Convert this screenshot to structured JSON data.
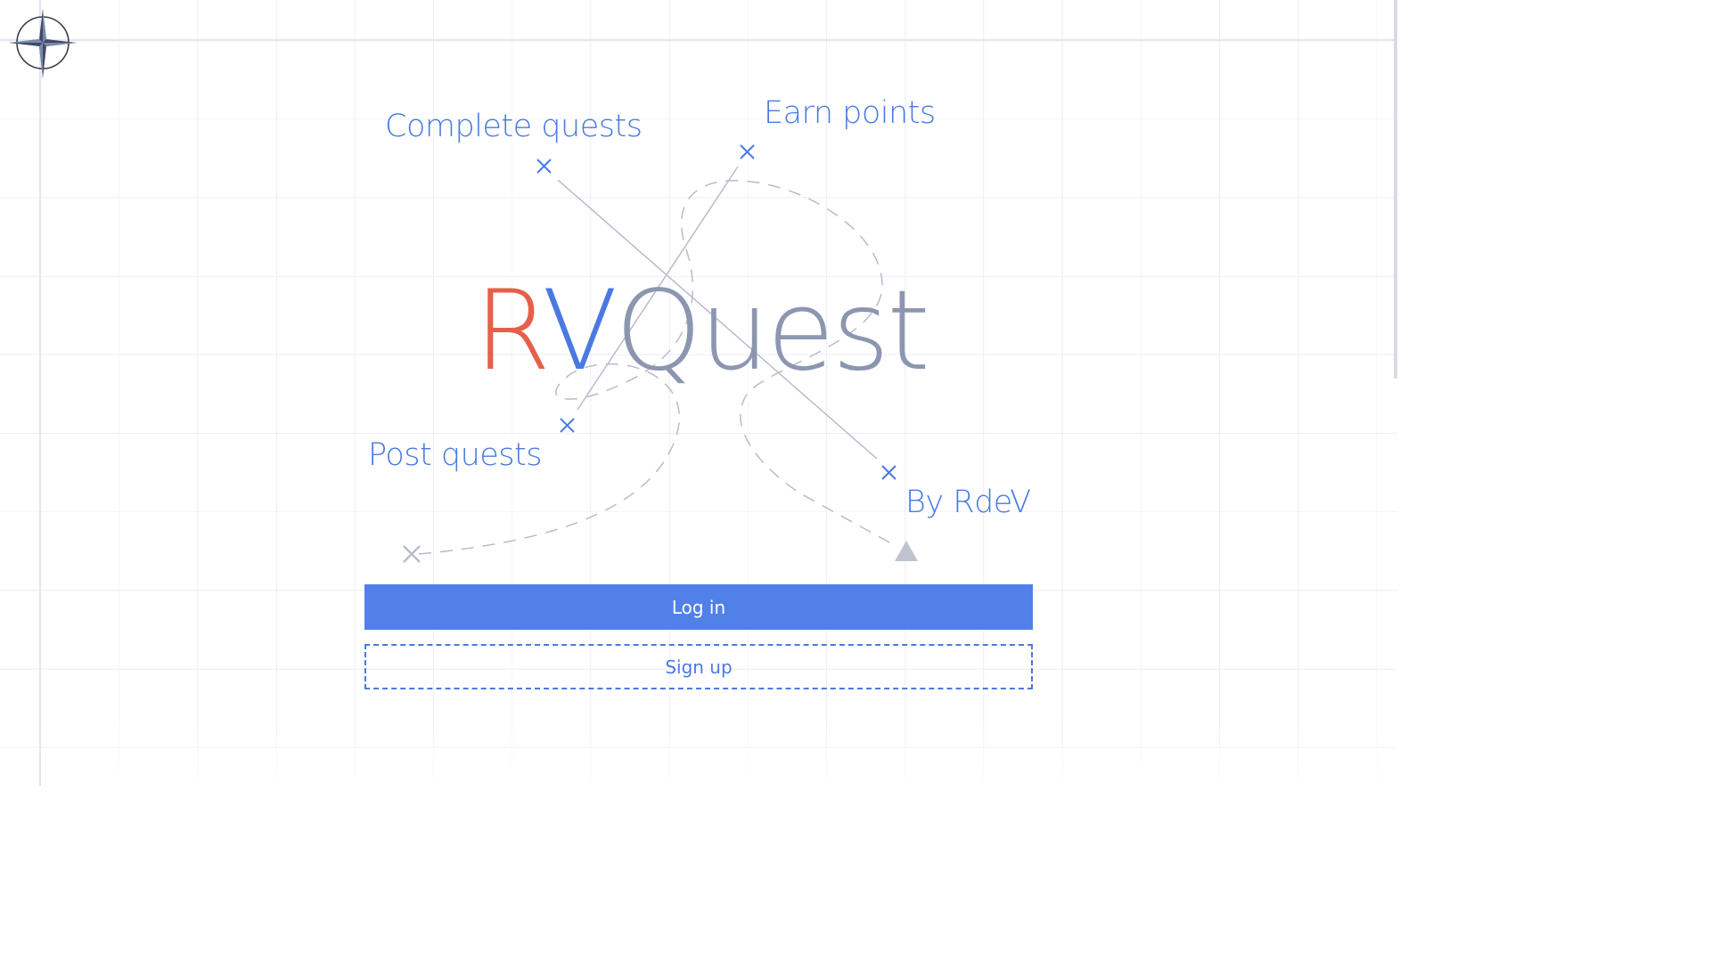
{
  "app": {
    "logo_r": "R",
    "logo_v": "V",
    "logo_rest": "Quest"
  },
  "features": {
    "complete": "Complete quests",
    "earn": "Earn points",
    "post": "Post quests",
    "by": "By RdeV"
  },
  "actions": {
    "login_label": "Log in",
    "signup_label": "Sign up"
  },
  "colors": {
    "accent": "#5080e8",
    "logo_r": "#e5604a",
    "logo_v": "#4a7ae0",
    "logo_rest": "#8c96b0"
  },
  "icons": {
    "compass": "compass-rose-icon",
    "marker": "x-marker-icon",
    "arrow": "triangle-arrow-icon"
  }
}
